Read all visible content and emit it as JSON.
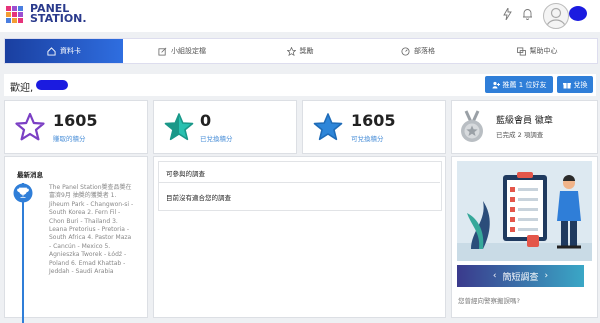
{
  "header": {
    "logo_text_1": "PANEL",
    "logo_text_2": "STATION.",
    "icons": [
      "lightning-icon",
      "bell-icon",
      "user-avatar-icon"
    ]
  },
  "tabs": [
    {
      "label": "資料卡",
      "icon": "home-icon",
      "active": true
    },
    {
      "label": "小組設定檔",
      "icon": "edit-icon",
      "active": false
    },
    {
      "label": "獎勵",
      "icon": "star-icon",
      "active": false
    },
    {
      "label": "部落格",
      "icon": "dashboard-icon",
      "active": false
    },
    {
      "label": "幫助中心",
      "icon": "chat-icon",
      "active": false
    }
  ],
  "welcome": {
    "greeting": "歡迎,",
    "refer_button": "推薦 1 位好友",
    "redeem_button": "兌換"
  },
  "stats": [
    {
      "value": "1605",
      "label": "賺取的積分",
      "icon": "star-outline-icon"
    },
    {
      "value": "0",
      "label": "已兌換積分",
      "icon": "star-teal-icon"
    },
    {
      "value": "1605",
      "label": "可兌換積分",
      "icon": "star-blue-icon"
    }
  ],
  "membership": {
    "title": "藍級會員 徽章",
    "subtitle": "已完成 2 項調查"
  },
  "news": {
    "title": "最新消息",
    "body": "The Panel Station獎查品獎在富濟9月 抽獎的獲獎者 1. Jiheum Park - Changwon-si - South Korea 2. Fern Fil - Chon Buri - Thailand 3. Leana Pretorius - Pretoria - South Africa 4. Pastor Maza - Cancún - Mexico 5. Agnieszka Tworek - Łódź - Poland 6. Emad Khattab - Jeddah - Saudi Arabia"
  },
  "surveys": {
    "header": "可參與的調查",
    "empty": "目前沒有適合您的調查"
  },
  "promo": {
    "button": "簡短調查",
    "link": "您曾經向警察搬誤嗎?"
  },
  "colors": {
    "accent": "#2f7ed8",
    "tab_active": "#1a3fa0",
    "promo_button": "#3aa7c6"
  }
}
